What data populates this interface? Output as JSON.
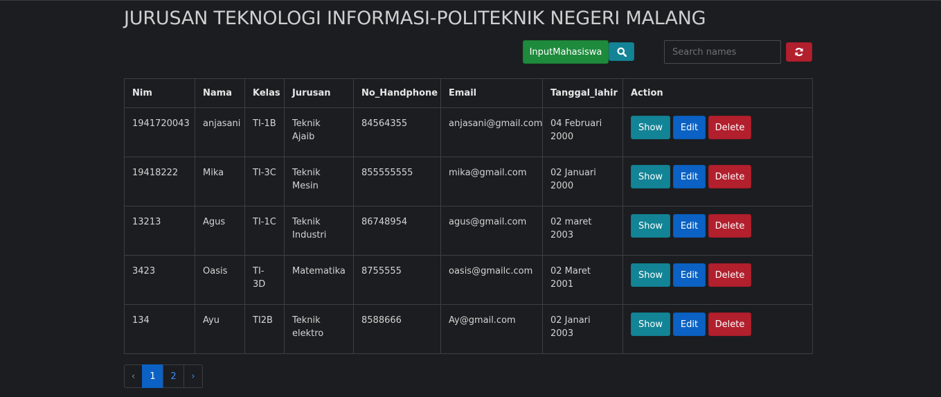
{
  "header": {
    "title": "JURUSAN TEKNOLOGI INFORMASI-POLITEKNIK NEGERI MALANG"
  },
  "toolbar": {
    "input_label": "InputMahasiswa",
    "search_icon": "search-icon",
    "search_placeholder": "Search names",
    "refresh_icon": "refresh-icon"
  },
  "table": {
    "columns": [
      "Nim",
      "Nama",
      "Kelas",
      "Jurusan",
      "No_Handphone",
      "Email",
      "Tanggal_lahir",
      "Action"
    ],
    "rows": [
      {
        "nim": "1941720043",
        "nama": "anjasani",
        "kelas": "TI-1B",
        "jurusan": "Teknik Ajaib",
        "hp": "84564355",
        "email": "anjasani@gmail.com",
        "tgl": "04 Februari 2000"
      },
      {
        "nim": "19418222",
        "nama": "Mika",
        "kelas": "TI-3C",
        "jurusan": "Teknik Mesin",
        "hp": "855555555",
        "email": "mika@gmail.com",
        "tgl": "02 Januari 2000"
      },
      {
        "nim": "13213",
        "nama": "Agus",
        "kelas": "TI-1C",
        "jurusan": "Teknik Industri",
        "hp": "86748954",
        "email": "agus@gmail.com",
        "tgl": "02 maret 2003"
      },
      {
        "nim": "3423",
        "nama": "Oasis",
        "kelas": "TI-3D",
        "jurusan": "Matematika",
        "hp": "8755555",
        "email": "oasis@gmailc.com",
        "tgl": "02 Maret 2001"
      },
      {
        "nim": "134",
        "nama": "Ayu",
        "kelas": "TI2B",
        "jurusan": "Teknik elektro",
        "hp": "8588666",
        "email": "Ay@gmail.com",
        "tgl": "02 Janari 2003"
      }
    ],
    "actions": {
      "show": "Show",
      "edit": "Edit",
      "delete": "Delete"
    }
  },
  "pagination": {
    "prev": "‹",
    "pages": [
      "1",
      "2"
    ],
    "active": "1",
    "next": "›"
  },
  "colors": {
    "background": "#1c1d20",
    "success": "#1e8a3c",
    "info": "#138496",
    "primary": "#0b62c4",
    "danger": "#b21f2d"
  }
}
